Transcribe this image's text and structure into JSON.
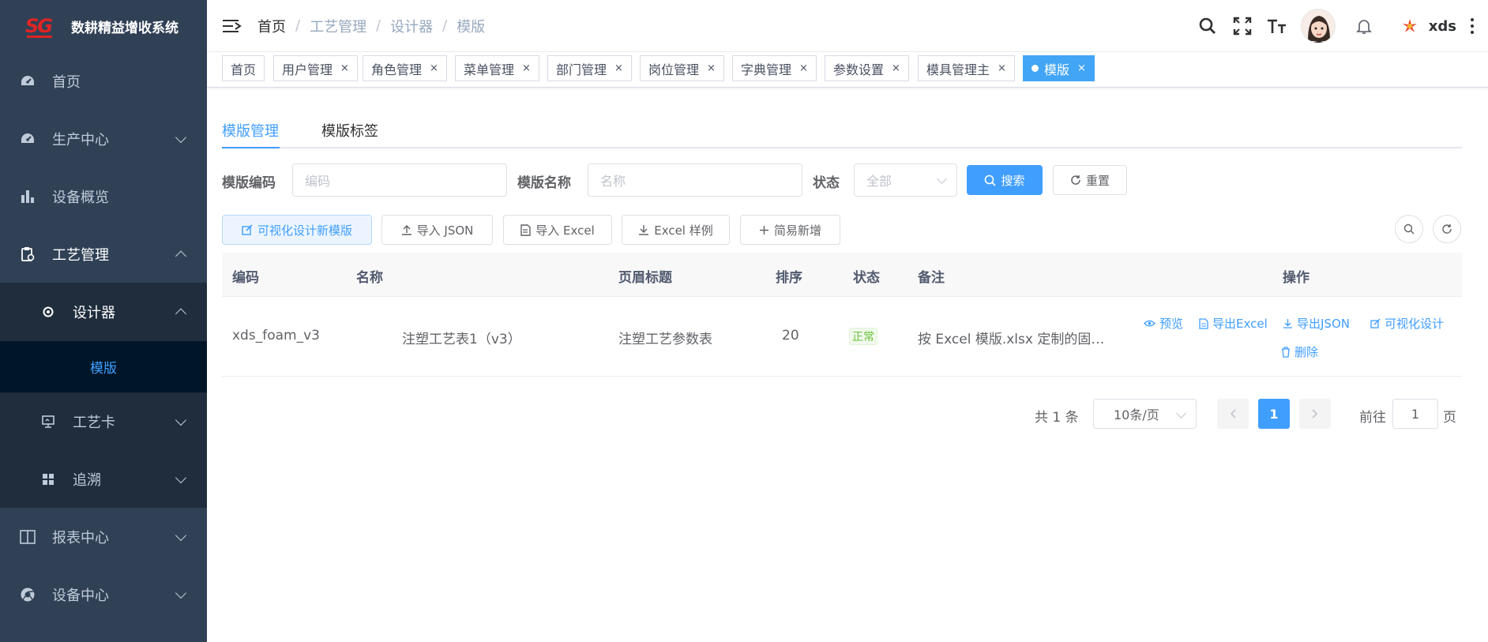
{
  "app": {
    "logo_text": "SG",
    "title": "数耕精益增收系统"
  },
  "sidebar": {
    "items": [
      {
        "label": "首页",
        "icon": "dashboard-icon"
      },
      {
        "label": "生产中心",
        "icon": "dashboard-icon"
      },
      {
        "label": "设备概览",
        "icon": "bar-chart-icon"
      },
      {
        "label": "工艺管理",
        "icon": "clipboard-icon"
      },
      {
        "label": "报表中心",
        "icon": "book-icon"
      },
      {
        "label": "设备中心",
        "icon": "chrome-icon"
      }
    ],
    "sub_items": [
      {
        "label": "设计器",
        "icon": "gear-icon"
      },
      {
        "label": "工艺卡",
        "icon": "monitor-icon"
      },
      {
        "label": "追溯",
        "icon": "grid-icon"
      }
    ],
    "active_leaf": "模版"
  },
  "header": {
    "breadcrumb": [
      "首页",
      "工艺管理",
      "设计器",
      "模版"
    ],
    "username": "xds"
  },
  "tags": [
    {
      "label": "首页",
      "closable": false
    },
    {
      "label": "用户管理",
      "closable": true
    },
    {
      "label": "角色管理",
      "closable": true
    },
    {
      "label": "菜单管理",
      "closable": true
    },
    {
      "label": "部门管理",
      "closable": true
    },
    {
      "label": "岗位管理",
      "closable": true
    },
    {
      "label": "字典管理",
      "closable": true
    },
    {
      "label": "参数设置",
      "closable": true
    },
    {
      "label": "模具管理主",
      "closable": true
    },
    {
      "label": "模版",
      "closable": true,
      "active": true
    }
  ],
  "tag_close": "×",
  "content_tabs": [
    "模版管理",
    "模版标签"
  ],
  "search": {
    "code_label": "模版编码",
    "code_placeholder": "编码",
    "name_label": "模版名称",
    "name_placeholder": "名称",
    "status_label": "状态",
    "status_value": "全部",
    "search_button": "搜索",
    "reset_button": "重置"
  },
  "toolbar": {
    "visual_new": "可视化设计新模版",
    "import_json": "导入 JSON",
    "import_excel": "导入 Excel",
    "excel_sample": "Excel 样例",
    "simple_add": "简易新增"
  },
  "table": {
    "columns": [
      "编码",
      "名称",
      "页眉标题",
      "排序",
      "状态",
      "备注",
      "操作"
    ],
    "rows": [
      {
        "code": "xds_foam_v3",
        "name": "注塑工艺表1（v3）",
        "header_title": "注塑工艺参数表",
        "sort": "20",
        "status": "正常",
        "remark": "按 Excel 模版.xlsx 定制的固…",
        "actions": [
          "预览",
          "导出Excel",
          "导出JSON",
          "可视化设计",
          "删除"
        ]
      }
    ]
  },
  "pagination": {
    "total_text": "共 1 条",
    "page_size": "10条/页",
    "current_page": "1",
    "goto_label": "前往",
    "goto_value": "1",
    "page_suffix": "页"
  },
  "colors": {
    "primary": "#409eff",
    "sidebar_bg": "#304156",
    "sidebar_sub_bg": "#1f2d3d",
    "success": "#67c23a",
    "brand_red": "#e02424"
  }
}
